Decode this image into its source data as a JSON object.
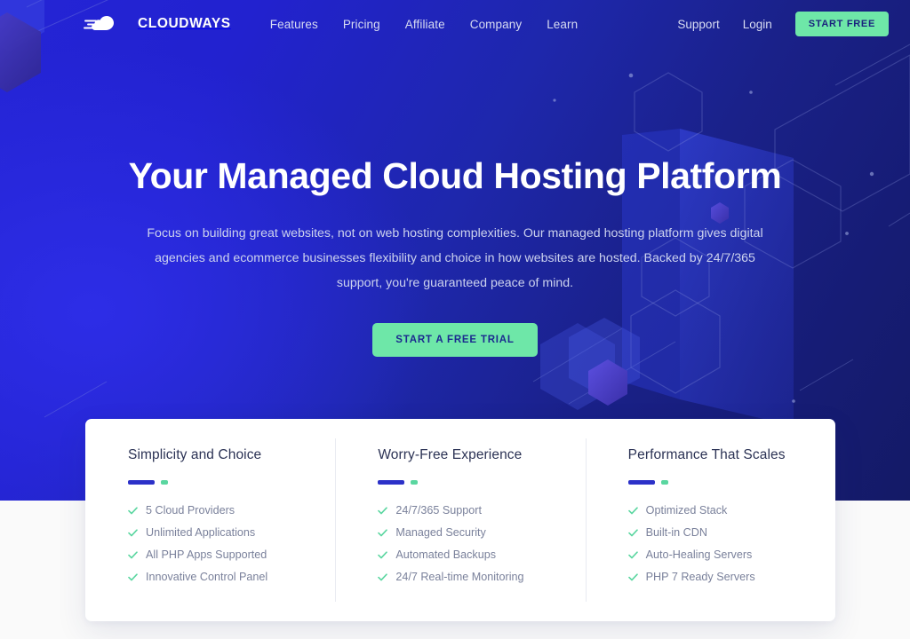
{
  "brand": {
    "name": "CLOUDWAYS",
    "logo_icon": "cloud-speed-icon",
    "accent_green": "#6ee7a8",
    "accent_blue": "#2c31c8",
    "hero_blue_left": "#2424d6",
    "hero_navy_right": "#141a66"
  },
  "header": {
    "nav": [
      {
        "label": "Features"
      },
      {
        "label": "Pricing"
      },
      {
        "label": "Affiliate"
      },
      {
        "label": "Company"
      },
      {
        "label": "Learn"
      }
    ],
    "support_label": "Support",
    "login_label": "Login",
    "start_free_label": "START FREE"
  },
  "hero": {
    "title": "Your Managed Cloud Hosting Platform",
    "subtitle": "Focus on building great websites, not on web hosting complexities. Our managed hosting platform gives digital agencies and ecommerce businesses flexibility and choice in how websites are hosted. Backed by 24/7/365 support, you're guaranteed peace of mind.",
    "cta_label": "START A FREE TRIAL"
  },
  "features": {
    "columns": [
      {
        "title": "Simplicity and Choice",
        "items": [
          "5 Cloud Providers",
          "Unlimited Applications",
          "All PHP Apps Supported",
          "Innovative Control Panel"
        ]
      },
      {
        "title": "Worry-Free Experience",
        "items": [
          "24/7/365 Support",
          "Managed Security",
          "Automated Backups",
          "24/7 Real-time Monitoring"
        ]
      },
      {
        "title": "Performance That Scales",
        "items": [
          "Optimized Stack",
          "Built-in CDN",
          "Auto-Healing Servers",
          "PHP 7 Ready Servers"
        ]
      }
    ]
  }
}
